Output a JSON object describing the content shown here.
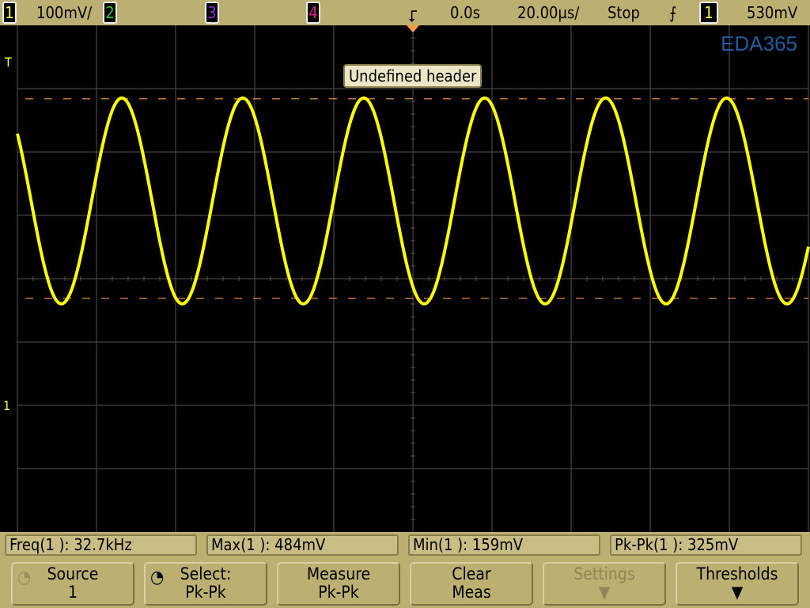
{
  "top": {
    "ch1_label": "1",
    "ch1_scale": "100mV/",
    "ch2_label": "2",
    "ch3_label": "3",
    "ch4_label": "4",
    "delay": "0.0s",
    "timebase": "20.00µs/",
    "run_state": "Stop",
    "trigger_slope_icon": "rising-edge",
    "trigger_source": "1",
    "trigger_level": "530mV"
  },
  "logo": "EDA365",
  "header_popup": "Undefined header",
  "markers": {
    "trigger_T": "T",
    "ground": "1"
  },
  "colors": {
    "ch1": "#ffff00",
    "ch2": "#33cc33",
    "ch3": "#8a2be2",
    "ch4": "#e0207a",
    "marker": "#ff9a40",
    "grid": "#555555"
  },
  "chart_data": {
    "type": "line",
    "signal": "sine",
    "frequency_khz": 32.7,
    "max_mv": 484,
    "min_mv": 159,
    "volts_per_div_mv": 100,
    "time_per_div_us": 20,
    "divisions": [
      10,
      8
    ]
  },
  "measurements": [
    {
      "label": "Freq(1 ): 32.7kHz"
    },
    {
      "label": "Max(1 ): 484mV"
    },
    {
      "label": "Min(1 ): 159mV"
    },
    {
      "label": "Pk-Pk(1 ): 325mV"
    }
  ],
  "softkeys": [
    {
      "line1": "Source",
      "line2": "1"
    },
    {
      "line1": "Select:",
      "line2": "Pk-Pk"
    },
    {
      "line1": "Measure",
      "line2": "Pk-Pk"
    },
    {
      "line1": "Clear",
      "line2": "Meas"
    },
    {
      "line1": "Settings",
      "line2": ""
    },
    {
      "line1": "Thresholds",
      "line2": ""
    }
  ]
}
